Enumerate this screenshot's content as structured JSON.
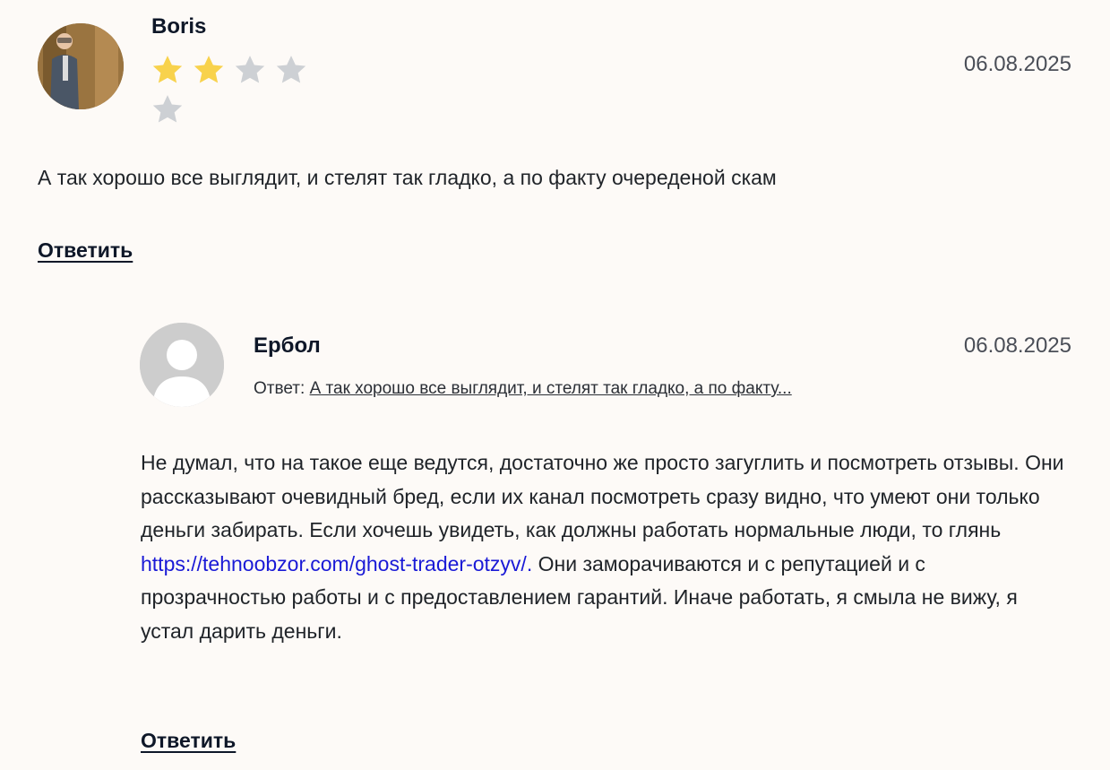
{
  "comments": [
    {
      "author": "Boris",
      "date": "06.08.2025",
      "rating": 2,
      "rating_max": 5,
      "text": "А так хорошо все выглядит, и стелят так гладко, а по факту очередeной скам",
      "reply_label": "Ответить"
    }
  ],
  "reply": {
    "author": "Ербол",
    "date": "06.08.2025",
    "reply_prefix": "Ответ:",
    "reply_to_text": "А так хорошо все выглядит, и стелят так гладко, а по факту...",
    "text_before_link": "Не думал, что на такое еще ведутся, достаточно же просто загуглить и посмотреть отзывы. Они рассказывают очевидный бред, если их канал посмотреть сразу видно, что умеют они только деньги забирать. Если хочешь увидеть, как должны работать нормальные люди, то глянь ",
    "link_text": "https://tehnoobzor.com/ghost-trader-otzyv/.",
    "text_after_link": " Они заморачиваются и с репутацией и с прозрачностью работы и с предоставлением гарантий. Иначе работать, я смыла не вижу, я устал дарить деньги.",
    "reply_label": "Ответить"
  },
  "colors": {
    "star_filled": "#f8d24c",
    "star_empty": "#cdd0d4",
    "link": "#1a1ad6",
    "background": "#fdfaf7"
  }
}
